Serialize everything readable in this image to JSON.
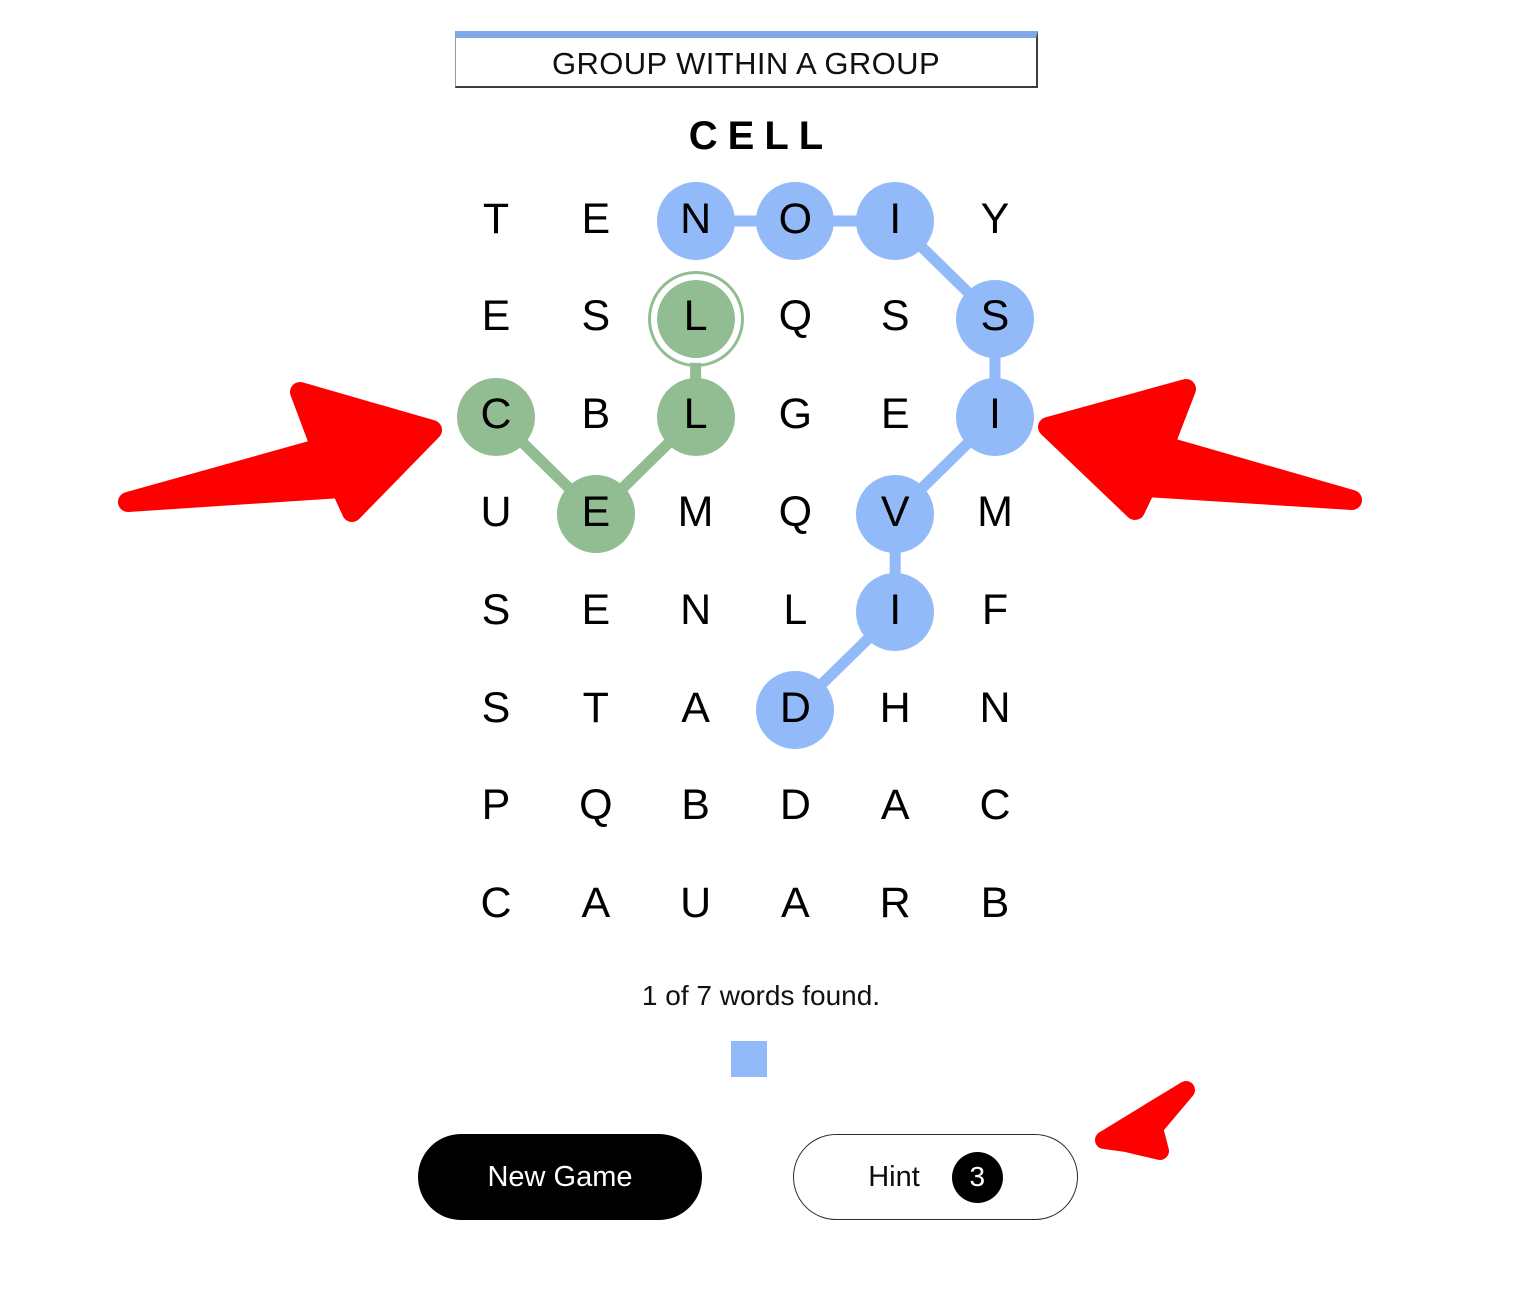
{
  "header": {
    "category_label": "GROUP WITHIN A GROUP",
    "accent_color": "#7FA8E8"
  },
  "current_word": "CELL",
  "status": {
    "text": "1 of 7 words found.",
    "found_count": 1,
    "total_words": 7
  },
  "legend": {
    "swatch_color": "#93BAF8"
  },
  "buttons": {
    "new_game_label": "New Game",
    "hint_label": "Hint",
    "hint_count": "3"
  },
  "colors": {
    "blue_selection": "#93BAF8",
    "green_selection": "#92BD92",
    "annotation_red": "#FF0000",
    "text": "#000000"
  },
  "grid": {
    "rows": 8,
    "cols": 6,
    "letters": [
      [
        "T",
        "E",
        "N",
        "O",
        "I",
        "Y"
      ],
      [
        "E",
        "S",
        "L",
        "Q",
        "S",
        "S"
      ],
      [
        "C",
        "B",
        "L",
        "G",
        "E",
        "I"
      ],
      [
        "U",
        "E",
        "M",
        "Q",
        "V",
        "M"
      ],
      [
        "S",
        "E",
        "N",
        "L",
        "I",
        "F"
      ],
      [
        "S",
        "T",
        "A",
        "D",
        "H",
        "N"
      ],
      [
        "P",
        "Q",
        "B",
        "D",
        "A",
        "C"
      ],
      [
        "C",
        "A",
        "U",
        "A",
        "R",
        "B"
      ]
    ],
    "selections": [
      {
        "name": "blue-path",
        "color": "#93BAF8",
        "cells": [
          {
            "row": 0,
            "col": 2,
            "letter": "N"
          },
          {
            "row": 0,
            "col": 3,
            "letter": "O"
          },
          {
            "row": 0,
            "col": 4,
            "letter": "I"
          },
          {
            "row": 1,
            "col": 5,
            "letter": "S"
          },
          {
            "row": 2,
            "col": 5,
            "letter": "I"
          },
          {
            "row": 3,
            "col": 4,
            "letter": "V"
          },
          {
            "row": 4,
            "col": 4,
            "letter": "I"
          },
          {
            "row": 5,
            "col": 3,
            "letter": "D"
          }
        ]
      },
      {
        "name": "green-path",
        "color": "#92BD92",
        "endpoint": {
          "row": 1,
          "col": 2
        },
        "cells": [
          {
            "row": 2,
            "col": 0,
            "letter": "C"
          },
          {
            "row": 3,
            "col": 1,
            "letter": "E"
          },
          {
            "row": 2,
            "col": 2,
            "letter": "L"
          },
          {
            "row": 1,
            "col": 2,
            "letter": "L"
          }
        ]
      }
    ]
  },
  "annotations": [
    {
      "name": "arrow-pointing-to-c-cell",
      "direction": "right",
      "color": "#FF0000"
    },
    {
      "name": "arrow-pointing-to-i-cell",
      "direction": "left",
      "color": "#FF0000"
    },
    {
      "name": "arrow-pointing-to-hint-button",
      "direction": "down-left",
      "color": "#FF0000"
    }
  ]
}
